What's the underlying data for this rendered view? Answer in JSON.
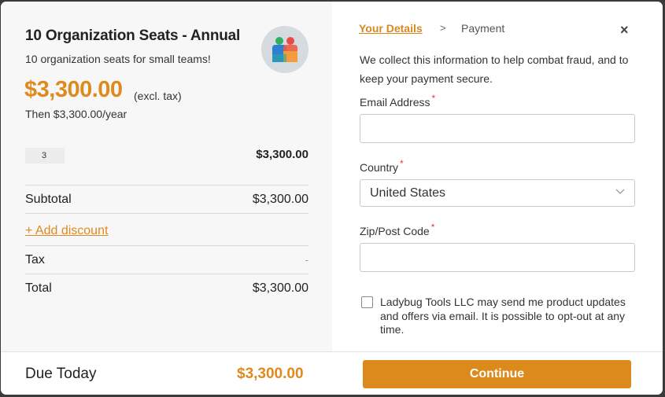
{
  "product": {
    "title": "10 Organization Seats - Annual",
    "description": "10 organization seats for small teams!",
    "price": "$3,300.00",
    "price_note": "(excl. tax)",
    "recurring": "Then $3,300.00/year",
    "quantity": "3",
    "line_amount": "$3,300.00"
  },
  "summary": {
    "subtotal_label": "Subtotal",
    "subtotal_value": "$3,300.00",
    "discount_label": "+ Add discount",
    "tax_label": "Tax",
    "tax_value": "-",
    "total_label": "Total",
    "total_value": "$3,300.00"
  },
  "footer": {
    "due_label": "Due Today",
    "due_value": "$3,300.00",
    "continue_label": "Continue"
  },
  "steps": {
    "active": "Your Details",
    "separator": ">",
    "next": "Payment",
    "close_glyph": "×"
  },
  "form": {
    "intro": "We collect this information to help combat fraud, and to keep your payment secure.",
    "email_label": "Email Address",
    "email_value": "",
    "country_label": "Country",
    "country_value": "United States",
    "zip_label": "Zip/Post Code",
    "zip_value": "",
    "required_mark": "*",
    "consent": "Ladybug Tools LLC may send me product updates and offers via email. It is possible to opt-out at any time.",
    "consent_checked": false
  },
  "colors": {
    "accent": "#dd8a1c",
    "required": "#e23b3b"
  },
  "icons": [
    "product-avatar-icon",
    "close-icon",
    "chevron-down-icon"
  ]
}
